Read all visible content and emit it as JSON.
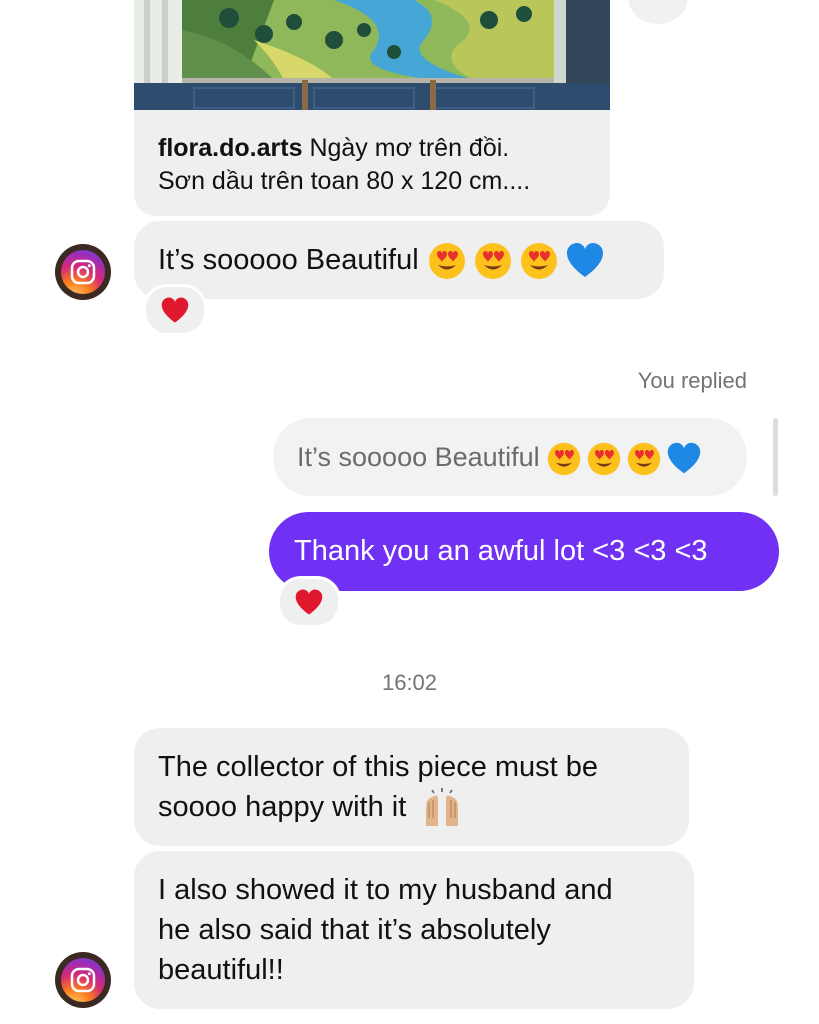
{
  "shared_post": {
    "username": "flora.do.arts",
    "caption_line1": "Ngày mơ trên đồi.",
    "caption_line2": "Sơn dầu trên toan 80 x 120 cm...."
  },
  "messages": {
    "incoming_1": {
      "text": "It’s sooooo Beautiful",
      "reaction": "heart"
    },
    "you_replied_label": "You replied",
    "quoted_text": "It’s sooooo Beautiful",
    "outgoing_1": {
      "text": "Thank you an awful lot <3 <3 <3",
      "reaction": "heart"
    },
    "timestamp": "16:02",
    "incoming_2": {
      "line1": "The collector of this piece must be",
      "line2": "soooo happy with it"
    },
    "incoming_3": {
      "line1": "I also showed it to my husband and",
      "line2": "he also said that it’s absolutely",
      "line3": "beautiful!!"
    }
  },
  "icons": {
    "avatar": "instagram-logo-icon",
    "reaction": "heart-icon",
    "emojis": [
      "heart-eyes-emoji",
      "heart-eyes-emoji",
      "heart-eyes-emoji",
      "blue-heart-emoji"
    ],
    "raising-hands": "raising-hands-emoji"
  },
  "colors": {
    "outgoing_bubble": "#7131f5",
    "incoming_bubble": "#efefef",
    "meta_text": "#737373"
  }
}
